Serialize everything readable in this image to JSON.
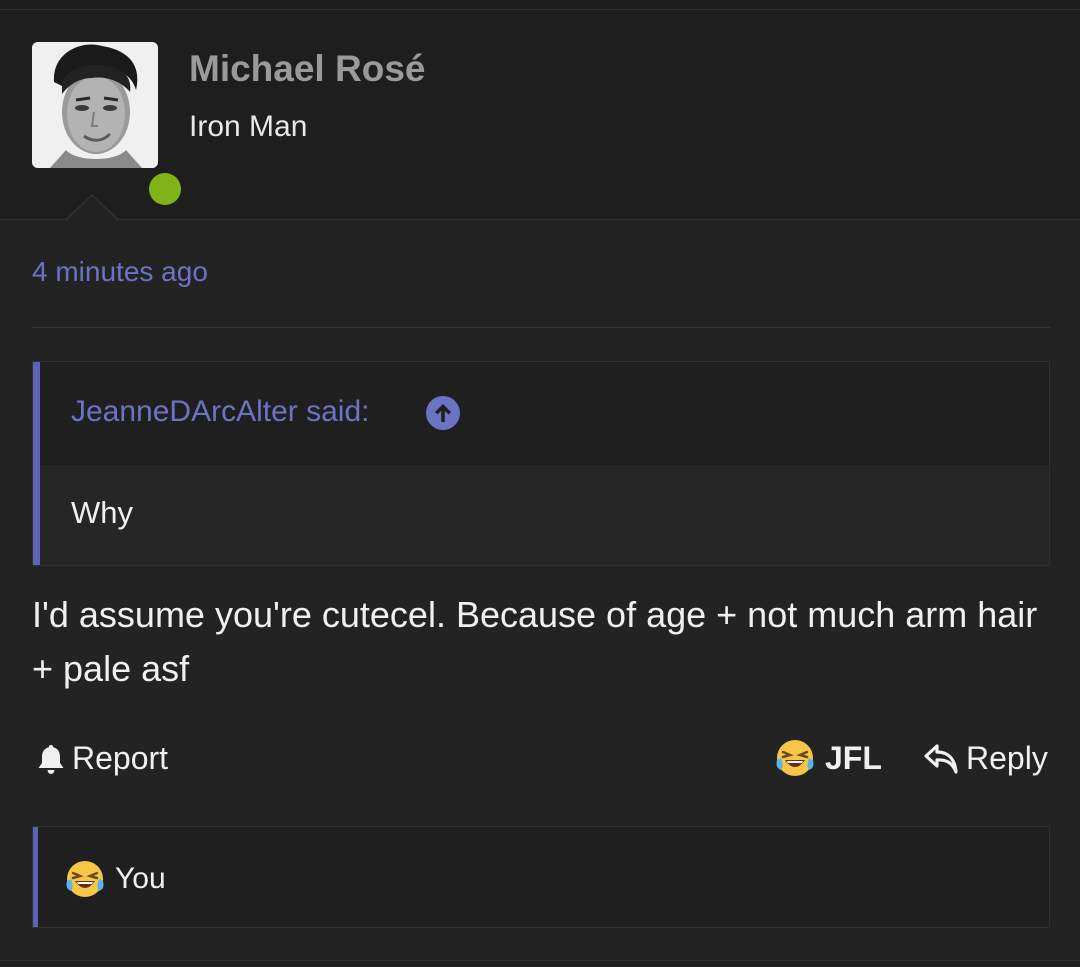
{
  "post": {
    "username": "Michael Rosé",
    "user_title": "Iron Man",
    "timestamp": "4 minutes ago",
    "quote": {
      "author": "JeanneDArcAlter said:",
      "text": "Why"
    },
    "body": "I'd assume you're cutecel. Because of age + not much arm hair + pale asf"
  },
  "actions": {
    "report_label": "Report",
    "reaction_label": "JFL",
    "reply_label": "Reply"
  },
  "reactions": {
    "reactors": "You"
  },
  "icons": {
    "avatar": "user-avatar-photo",
    "online": "online-status-dot",
    "quote_jump": "arrow-up-circle-icon",
    "report": "bell-icon",
    "reaction": "laughing-crying-emoji-icon",
    "reply": "reply-arrow-icon"
  },
  "colors": {
    "accent": "#6b74c4",
    "quote_bar": "#5d64b6",
    "online": "#7fb318",
    "username": "#9a9a9a"
  }
}
